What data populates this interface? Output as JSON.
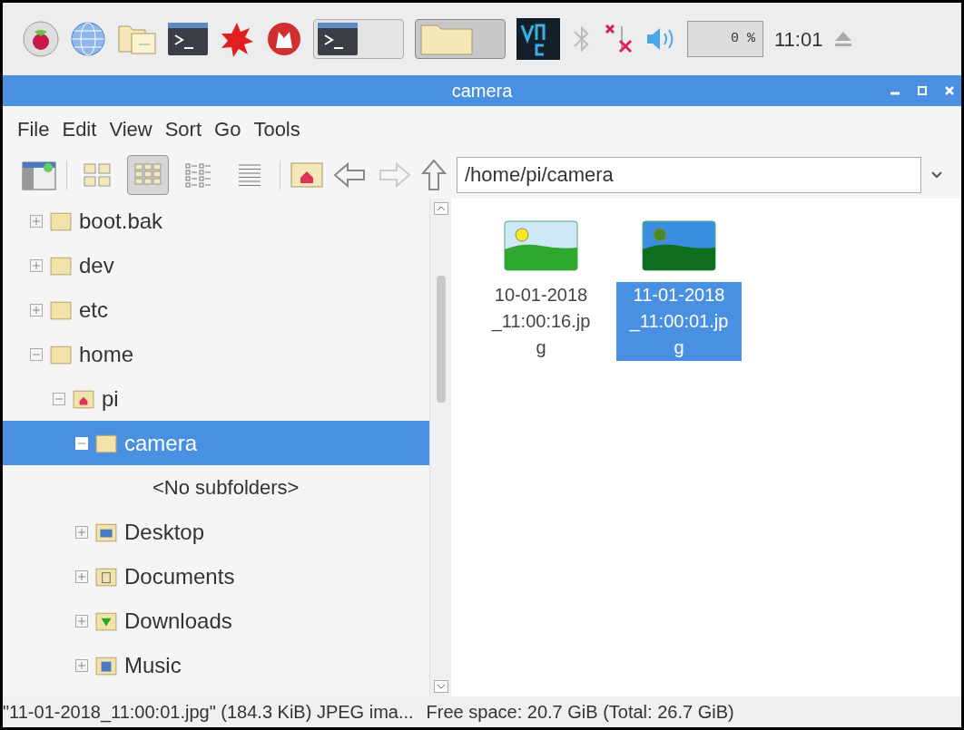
{
  "taskbar": {
    "launchers": [
      {
        "kind": "raspberry"
      },
      {
        "kind": "globe"
      },
      {
        "kind": "files"
      },
      {
        "kind": "terminal"
      },
      {
        "kind": "burst"
      },
      {
        "kind": "wolf"
      }
    ],
    "windows": [
      {
        "kind": "terminal",
        "selected": false
      },
      {
        "kind": "folder",
        "selected": true
      }
    ],
    "tray": {
      "cpu": "0 %",
      "clock": "11:01"
    }
  },
  "window": {
    "title": "camera"
  },
  "menu": [
    "File",
    "Edit",
    "View",
    "Sort",
    "Go",
    "Tools"
  ],
  "toolbar": {
    "views": [
      {
        "kind": "icons",
        "selected": false
      },
      {
        "kind": "thumbnails",
        "selected": true
      },
      {
        "kind": "compact",
        "selected": false
      },
      {
        "kind": "list",
        "selected": false
      }
    ],
    "location": "/home/pi/camera"
  },
  "tree": [
    {
      "label": "boot.bak",
      "kind": "folder",
      "expanded": false,
      "selected": false
    },
    {
      "label": "dev",
      "kind": "folder",
      "expanded": false,
      "selected": false
    },
    {
      "label": "etc",
      "kind": "folder",
      "expanded": false,
      "selected": false
    },
    {
      "label": "home",
      "kind": "folder",
      "expanded": true,
      "selected": false,
      "children": [
        {
          "label": "pi",
          "kind": "home",
          "expanded": true,
          "selected": false,
          "children": [
            {
              "label": "camera",
              "kind": "folder",
              "expanded": true,
              "selected": true,
              "empty_note": "<No subfolders>"
            },
            {
              "label": "Desktop",
              "kind": "desktop",
              "expanded": false,
              "selected": false
            },
            {
              "label": "Documents",
              "kind": "documents",
              "expanded": false,
              "selected": false
            },
            {
              "label": "Downloads",
              "kind": "downloads",
              "expanded": false,
              "selected": false
            },
            {
              "label": "Music",
              "kind": "music",
              "expanded": false,
              "selected": false
            }
          ]
        }
      ]
    }
  ],
  "files": [
    {
      "name": "10-01-2018_11:00:16.jpg",
      "selected": false
    },
    {
      "name": "11-01-2018_11:00:01.jpg",
      "selected": true
    }
  ],
  "status_bar": {
    "selection": "\"11-01-2018_11:00:01.jpg\" (184.3 KiB) JPEG ima...",
    "free_space": "Free space: 20.7 GiB (Total: 26.7 GiB)"
  }
}
